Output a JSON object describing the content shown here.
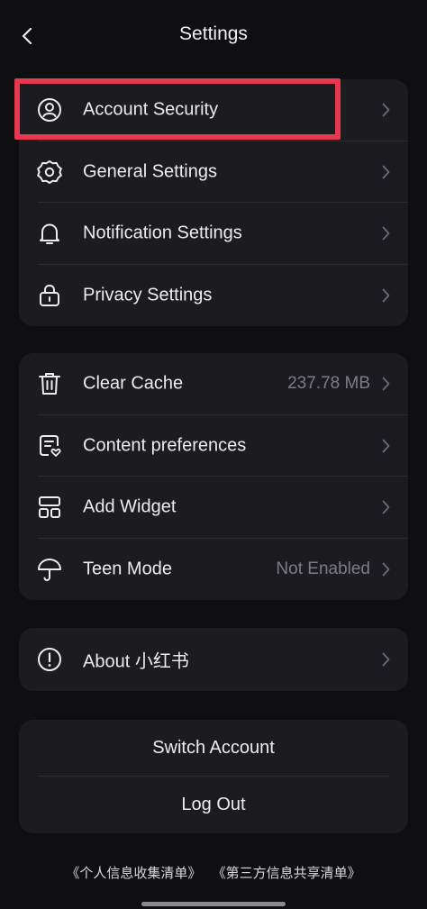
{
  "header": {
    "title": "Settings"
  },
  "group1": [
    {
      "label": "Account Security",
      "icon": "user-circle-icon"
    },
    {
      "label": "General Settings",
      "icon": "gear-icon"
    },
    {
      "label": "Notification Settings",
      "icon": "bell-icon"
    },
    {
      "label": "Privacy Settings",
      "icon": "lock-icon"
    }
  ],
  "group2": [
    {
      "label": "Clear Cache",
      "value": "237.78 MB",
      "icon": "trash-icon"
    },
    {
      "label": "Content preferences",
      "value": "",
      "icon": "document-heart-icon"
    },
    {
      "label": "Add Widget",
      "value": "",
      "icon": "widget-icon"
    },
    {
      "label": "Teen Mode",
      "value": "Not Enabled",
      "icon": "umbrella-icon"
    }
  ],
  "group3": [
    {
      "label": "About 小红书",
      "icon": "info-icon"
    }
  ],
  "account": {
    "switch_label": "Switch Account",
    "logout_label": "Log Out"
  },
  "footer": {
    "link1": "《个人信息收集清单》",
    "link2": "《第三方信息共享清单》"
  },
  "colors": {
    "highlight": "#e8384f",
    "card": "#1c1c20",
    "background": "#0f0f11"
  }
}
